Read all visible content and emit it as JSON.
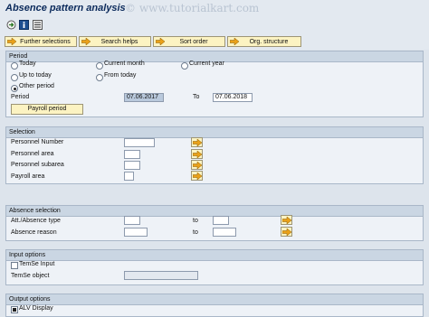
{
  "title": "Absence pattern analysis",
  "watermark": "© www.tutorialkart.com",
  "toolbar": {
    "icons": [
      "execute-icon",
      "info-icon",
      "variants-icon"
    ]
  },
  "app_toolbar": {
    "further_selections": "Further selections",
    "search_helps": "Search helps",
    "sort_order": "Sort order",
    "org_structure": "Org. structure"
  },
  "period": {
    "title": "Period",
    "today": "Today",
    "current_month": "Current month",
    "current_year": "Current year",
    "up_to_today": "Up to today",
    "from_today": "From today",
    "other_period": "Other period",
    "selected": "Other period",
    "period_label": "Period",
    "from_value": "07.06.2017",
    "to_label": "To",
    "to_value": "07.06.2018",
    "payroll_period": "Payroll period"
  },
  "selection": {
    "title": "Selection",
    "personnel_number": "Personnel Number",
    "personnel_area": "Personnel area",
    "personnel_subarea": "Personnel subarea",
    "payroll_area": "Payroll area"
  },
  "absence_selection": {
    "title": "Absence selection",
    "att_absence_type": "Att./Absence type",
    "absence_reason": "Absence reason",
    "to1": "to",
    "to2": "to"
  },
  "input_options": {
    "title": "Input options",
    "temse_input": "TemSe Input",
    "temse_object": "TemSe object"
  },
  "output_options": {
    "title": "Output options",
    "alv_display": "ALV Display",
    "alv_checked": true
  },
  "colors": {
    "button_bg": "#fcf3c2",
    "frame_header": "#cad6e3",
    "arrow": "#e9a11a"
  }
}
